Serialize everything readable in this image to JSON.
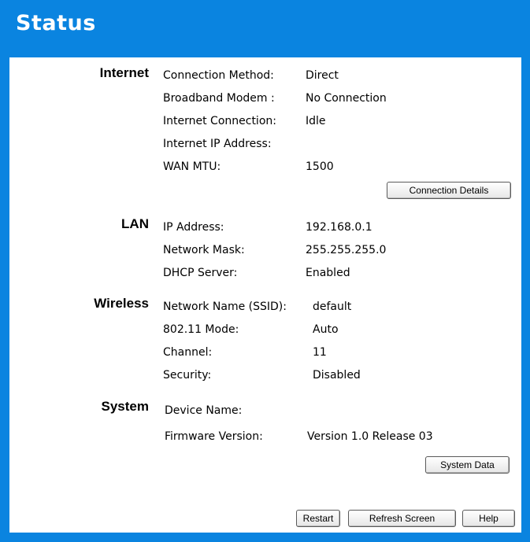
{
  "page": {
    "title": "Status"
  },
  "internet": {
    "heading": "Internet",
    "rows": [
      {
        "label": "Connection Method:",
        "value": "Direct"
      },
      {
        "label": "Broadband Modem :",
        "value": "No Connection"
      },
      {
        "label": "Internet Connection:",
        "value": "Idle"
      },
      {
        "label": "Internet IP Address:",
        "value": ""
      },
      {
        "label": "WAN MTU:",
        "value": "1500"
      }
    ],
    "details_button": "Connection Details"
  },
  "lan": {
    "heading": "LAN",
    "rows": [
      {
        "label": "IP Address:",
        "value": "192.168.0.1"
      },
      {
        "label": "Network Mask:",
        "value": "255.255.255.0"
      },
      {
        "label": "DHCP Server:",
        "value": "Enabled"
      }
    ]
  },
  "wireless": {
    "heading": "Wireless",
    "rows": [
      {
        "label": "Network Name (SSID):",
        "value": "default"
      },
      {
        "label": "802.11 Mode:",
        "value": "Auto"
      },
      {
        "label": "Channel:",
        "value": "11"
      },
      {
        "label": "Security:",
        "value": "Disabled"
      }
    ]
  },
  "system": {
    "heading": "System",
    "rows": [
      {
        "label": "Device Name:",
        "value": ""
      },
      {
        "label": "Firmware Version:",
        "value": "Version 1.0 Release 03"
      }
    ],
    "data_button": "System Data"
  },
  "footer": {
    "restart": "Restart",
    "refresh": "Refresh Screen",
    "help": "Help"
  }
}
